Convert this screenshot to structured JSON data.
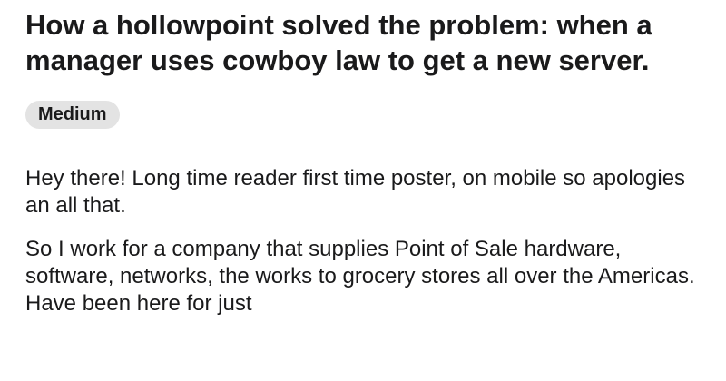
{
  "post": {
    "title": "How a hollowpoint solved the problem: when a manager uses cowboy law to get a new server.",
    "flair": "Medium",
    "paragraphs": [
      "Hey there!  Long time reader first time poster, on mobile so apologies an all that.",
      "So I work for a company that supplies Point of Sale hardware, software, networks, the works to grocery stores all over the Americas.  Have been here for just"
    ]
  }
}
